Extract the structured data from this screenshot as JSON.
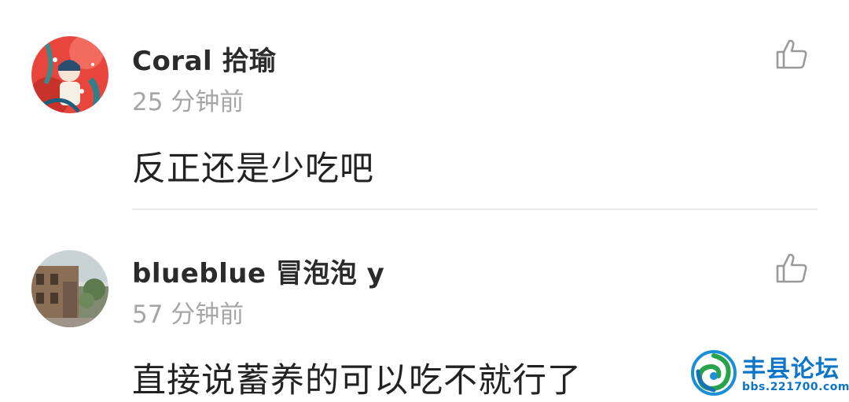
{
  "comments": [
    {
      "username": "Coral 拾瑜",
      "time": "25 分钟前",
      "content": "反正还是少吃吧",
      "avatar_icon": "illustrated-girl-avatar",
      "like_icon": "thumbs-up-outline-icon"
    },
    {
      "username": "blueblue 冒泡泡 y",
      "time": "57 分钟前",
      "content": "直接说蓄养的可以吃不就行了",
      "avatar_icon": "building-photo-avatar",
      "like_icon": "thumbs-up-outline-icon"
    }
  ],
  "watermark": {
    "title": "丰县论坛",
    "url": "bbs.221700.com",
    "logo_icon": "swirl-logo"
  },
  "colors": {
    "username": "#2b2b2b",
    "time": "#a6a6a6",
    "content": "#222222",
    "divider": "#e9e9e9",
    "watermark": "#0c75c8"
  }
}
